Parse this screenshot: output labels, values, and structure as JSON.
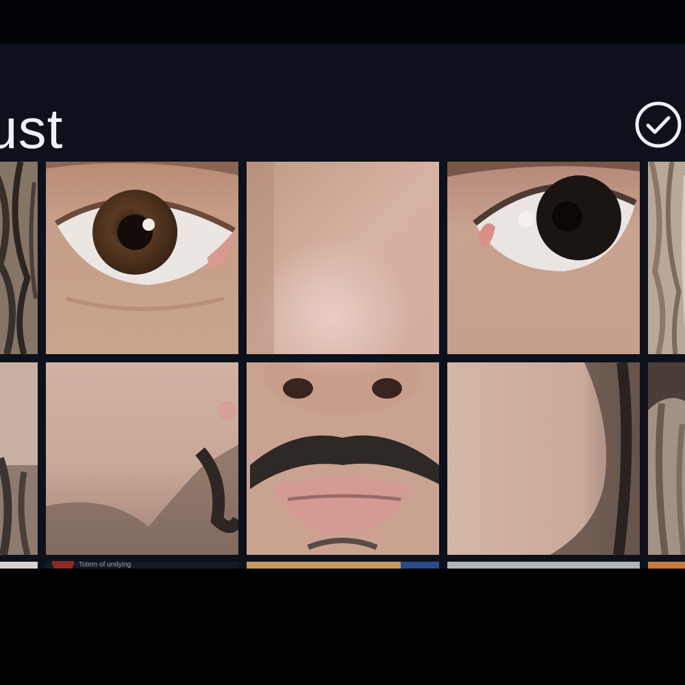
{
  "header": {
    "title": "ust",
    "confirm_icon": "check-circle-icon"
  },
  "grid": {
    "rows": 2,
    "tiles": [
      {
        "name": "tile-hair-top-left",
        "content": "hair"
      },
      {
        "name": "tile-right-eye",
        "content": "eye"
      },
      {
        "name": "tile-forehead-nose-bridge",
        "content": "skin"
      },
      {
        "name": "tile-left-eye",
        "content": "eye"
      },
      {
        "name": "tile-hair-top-right",
        "content": "hair"
      },
      {
        "name": "tile-beard-left-edge",
        "content": "beard"
      },
      {
        "name": "tile-left-cheek",
        "content": "cheek"
      },
      {
        "name": "tile-nose-mouth",
        "content": "mouth"
      },
      {
        "name": "tile-right-cheek",
        "content": "cheek"
      },
      {
        "name": "tile-beard-right-edge",
        "content": "beard"
      }
    ]
  },
  "next_row": {
    "caption": "Totem of undying"
  },
  "colors": {
    "header_bg": "#0d111b",
    "grid_bg": "#0d111b",
    "page_bg": "#000000",
    "text": "#eef0f4"
  }
}
